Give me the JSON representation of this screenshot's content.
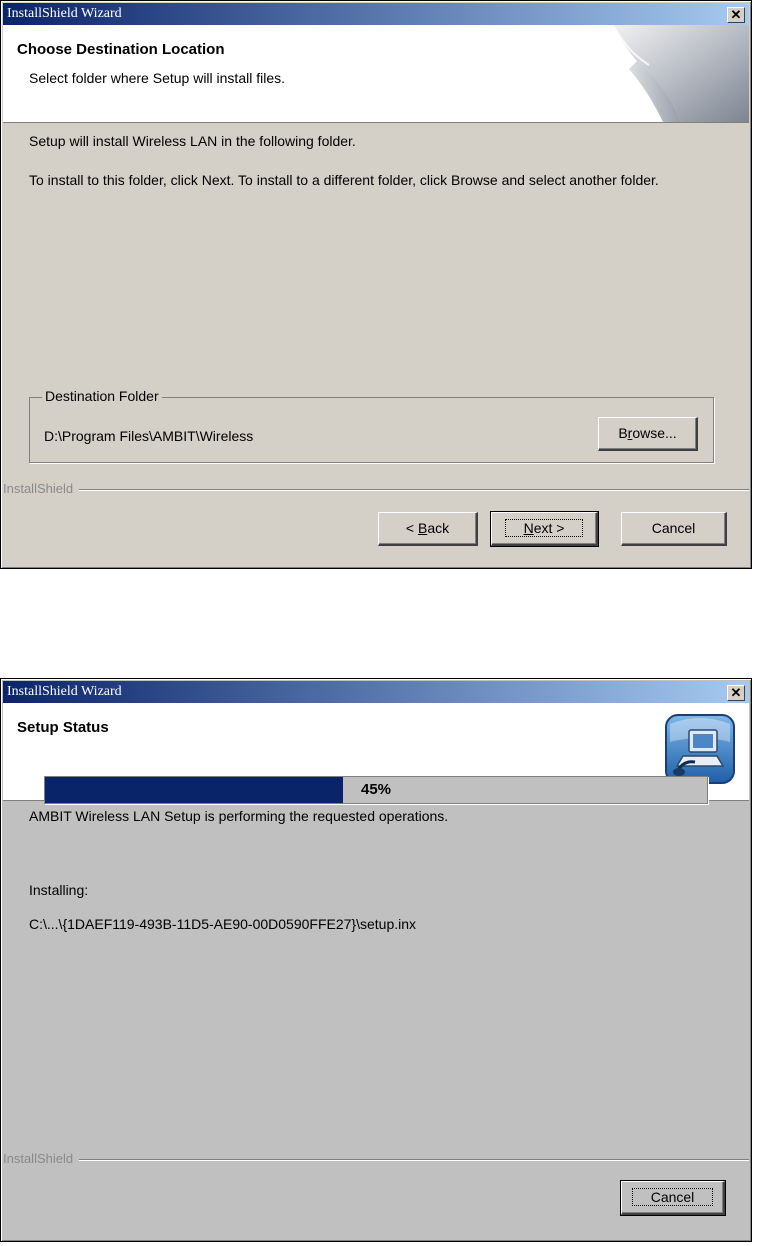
{
  "dialog1": {
    "title": "InstallShield Wizard",
    "close_label": "✕",
    "header_title": "Choose Destination Location",
    "header_subtitle": "Select folder where Setup will install files.",
    "line1": "Setup will install Wireless LAN in the following folder.",
    "line2": "To install to this folder, click Next. To install to a different folder, click Browse and select another folder.",
    "group_label": "Destination Folder",
    "folder_path": "D:\\Program Files\\AMBIT\\Wireless",
    "browse_label": "Browse...",
    "brand": "InstallShield",
    "back_label": "< Back",
    "next_label": "Next >",
    "cancel_label": "Cancel"
  },
  "dialog2": {
    "title": "InstallShield Wizard",
    "close_label": "✕",
    "header_title": "Setup Status",
    "status_text": "AMBIT Wireless LAN Setup is performing the requested operations.",
    "installing_label": "Installing:",
    "current_file": "C:\\...\\{1DAEF119-493B-11D5-AE90-00D0590FFE27}\\setup.inx",
    "progress_percent": 45,
    "progress_label": "45%",
    "brand": "InstallShield",
    "cancel_label": "Cancel"
  },
  "icons": {
    "header_art": "page-curl-graphic",
    "setup_icon": "computer-setup-icon"
  },
  "colors": {
    "dialog_bg": "#d4d0c8",
    "progress_fill": "#0a246a",
    "titlebar_start": "#0a246a",
    "titlebar_end": "#a6caf0"
  }
}
